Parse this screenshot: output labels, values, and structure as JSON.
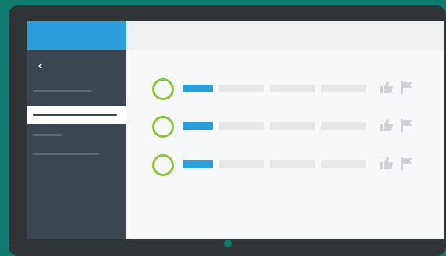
{
  "sidebar": {
    "back_glyph": "‹",
    "accent_color": "#2b9fdc",
    "background_color": "#3b4650"
  },
  "list": {
    "status_color": "#8cc63f",
    "rows": [
      {
        "icons": [
          "circle-outline-icon",
          "thumbs-up-icon",
          "flag-icon"
        ]
      },
      {
        "icons": [
          "circle-outline-icon",
          "thumbs-up-icon",
          "flag-icon"
        ]
      },
      {
        "icons": [
          "circle-outline-icon",
          "thumbs-up-icon",
          "flag-icon"
        ]
      }
    ]
  },
  "colors": {
    "background": "#0f7a6e",
    "monitor": "#2f3436",
    "placeholder_bar": "#e5e7e9",
    "icon_gray": "#cfd3d6"
  }
}
